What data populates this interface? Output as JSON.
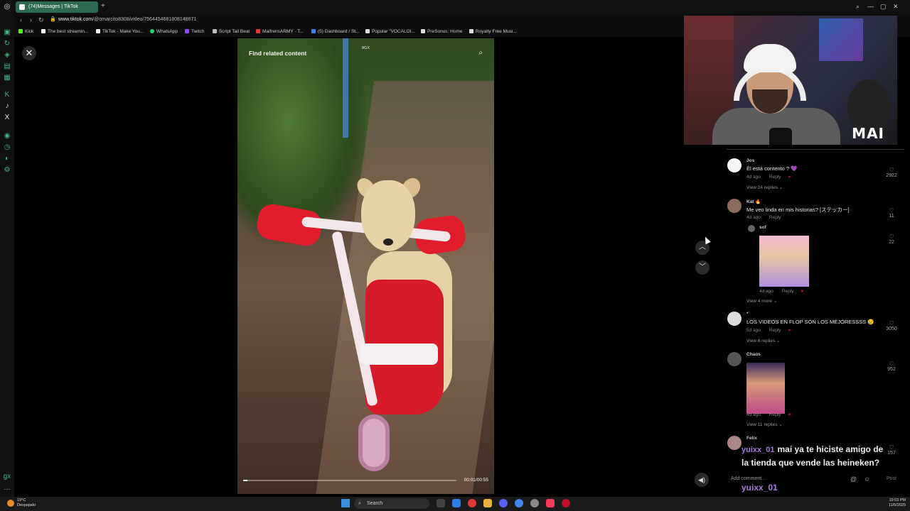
{
  "browser": {
    "tab_title": "(74)Messages | TikTok",
    "url_host": "www.tiktok.com",
    "url_path": "/@omarcito8308/video/7564454681808148871",
    "bookmarks": [
      {
        "label": "Kick",
        "color": "#53fc18"
      },
      {
        "label": "The best streamin...",
        "color": "#ffffff"
      },
      {
        "label": "TikTok - Make You...",
        "color": "#ffffff"
      },
      {
        "label": "WhatsApp",
        "color": "#25d366"
      },
      {
        "label": "Twitch",
        "color": "#9146ff"
      },
      {
        "label": "Script Tail Beat",
        "color": "#bbbbbb"
      },
      {
        "label": "MaifrensARMY - T...",
        "color": "#e53935"
      },
      {
        "label": "(5) Dashboard / St...",
        "color": "#3b82f6"
      },
      {
        "label": "Popular \"VOCALOI...",
        "color": "#dddddd"
      },
      {
        "label": "PreSonus: Home",
        "color": "#dddddd"
      },
      {
        "label": "Royalty Free Musi...",
        "color": "#dddddd"
      }
    ]
  },
  "video": {
    "title": "Find related content",
    "watermark": "8GX",
    "time": "00:01/00:55",
    "progress": 0.02
  },
  "webcam": {
    "logo": "MAI"
  },
  "comments": [
    {
      "user": "Jos",
      "text": "Él está contento ? 💜",
      "age": "4d ago",
      "reply": "Reply",
      "likes": "2922",
      "view_replies": "View 24 replies ⌄"
    },
    {
      "user": "Kat 🔥",
      "text": "Me veo linda en mis historias? [ステッカー]",
      "age": "4d ago",
      "reply": "Reply",
      "likes": "11"
    },
    {
      "user": "sof",
      "text": "",
      "age": "4d ago",
      "reply": "Reply",
      "likes": "22",
      "view_replies": "View 4 more ⌄"
    },
    {
      "user": "*ʿ",
      "text": "LOS VIDEOS EN FLOP SON LOS MEJORESSSS 😢",
      "age": "5d ago",
      "reply": "Reply",
      "likes": "3050",
      "view_replies": "View 6 replies ⌄"
    },
    {
      "user": "Chaos",
      "text": "",
      "age": "4d ago",
      "reply": "Reply",
      "likes": "952",
      "view_replies": "View 11 replies ⌄"
    },
    {
      "user": "Felix",
      "text": "",
      "likes": "157"
    }
  ],
  "chat": {
    "user1": "yuixx_01",
    "message": "mai ya te hiciste amigo de la tienda que vende las heineken?",
    "user2": "yuixx_01"
  },
  "comment_box": {
    "placeholder": "Add comment...",
    "post": "Post"
  },
  "taskbar": {
    "temp": "19°C",
    "weather": "Despejado",
    "search": "Search",
    "time": "10:03 PM",
    "date": "11/5/2025"
  }
}
